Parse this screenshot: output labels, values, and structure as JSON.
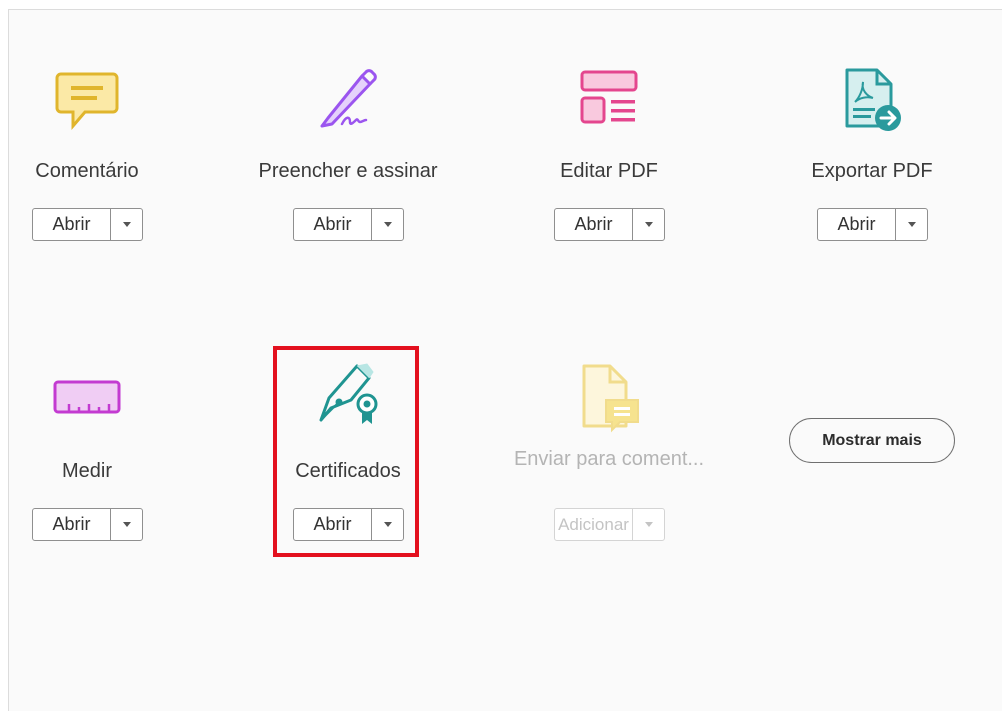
{
  "tools": [
    {
      "label": "Comentário",
      "open_label": "Abrir",
      "icon": "comment-icon",
      "color": "#f6d35e"
    },
    {
      "label": "Preencher e assinar",
      "open_label": "Abrir",
      "icon": "fill-sign-pen-icon",
      "color": "#a463f2"
    },
    {
      "label": "Editar PDF",
      "open_label": "Abrir",
      "icon": "edit-pdf-icon",
      "color": "#ec4d96"
    },
    {
      "label": "Exportar PDF",
      "open_label": "Abrir",
      "icon": "export-pdf-icon",
      "color": "#33a4a7"
    },
    {
      "label": "Medir",
      "open_label": "Abrir",
      "icon": "ruler-icon",
      "color": "#c84ad6"
    },
    {
      "label": "Certificados",
      "open_label": "Abrir",
      "icon": "certificate-pen-icon",
      "color": "#1f9c99"
    },
    {
      "label": "Enviar para coment...",
      "open_label": "Adicionar",
      "icon": "send-comment-icon",
      "color": "#f3dc8a",
      "disabled": true
    }
  ],
  "show_more_label": "Mostrar mais",
  "highlight_color": "#e3101e"
}
